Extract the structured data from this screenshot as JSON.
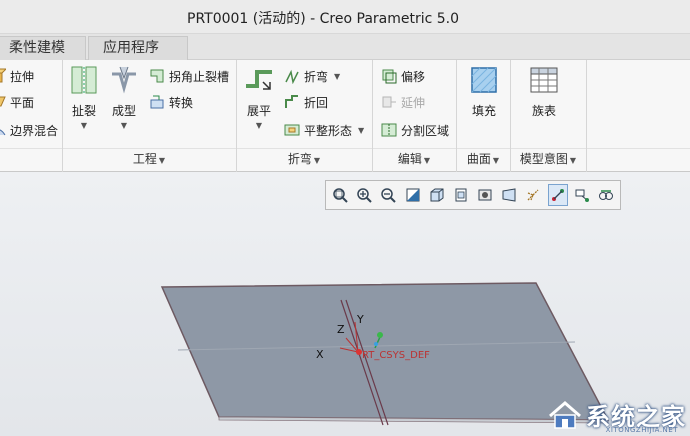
{
  "window": {
    "title": "PRT0001 (活动的) - Creo Parametric 5.0"
  },
  "tabs": [
    {
      "label": "柔性建模"
    },
    {
      "label": "应用程序"
    }
  ],
  "ribbon": {
    "shapes": {
      "extrude": "拉伸",
      "plane": "平面",
      "boundary_blend": "边界混合"
    },
    "engineering": {
      "label": "工程",
      "rip": "扯裂",
      "form": "成型",
      "corner_relief": "拐角止裂槽",
      "convert": "转换"
    },
    "bends": {
      "label": "折弯",
      "unbend": "展平",
      "bend": "折弯",
      "bend_back": "折回",
      "flat_state": "平整形态"
    },
    "editing": {
      "label": "编辑",
      "offset": "偏移",
      "extend": "延伸",
      "split_area": "分割区域"
    },
    "surfaces": {
      "label": "曲面",
      "fill": "填充"
    },
    "model_intent": {
      "label": "模型意图",
      "family_table": "族表"
    }
  },
  "viewport": {
    "csys_label": "RT_CSYS_DEF",
    "axis_x": "X",
    "axis_y": "Y",
    "axis_z": "Z",
    "toolbar_icons": [
      "refit-icon",
      "zoom-in-icon",
      "zoom-out-icon",
      "repaint-icon",
      "display-style-icon",
      "saved-orientations-icon",
      "view-manager-icon",
      "perspective-view-icon",
      "datum-display-icon",
      "spin-center-icon",
      "annotation-display-icon",
      "appearance-icon"
    ]
  },
  "watermark": {
    "text": "系统之家",
    "sub": "XITONGZHIJIA.NET"
  },
  "colors": {
    "sheet": "#8e98a6",
    "ribbon_bg": "#f7f7f7",
    "accent_active": "#7aa3cf"
  }
}
